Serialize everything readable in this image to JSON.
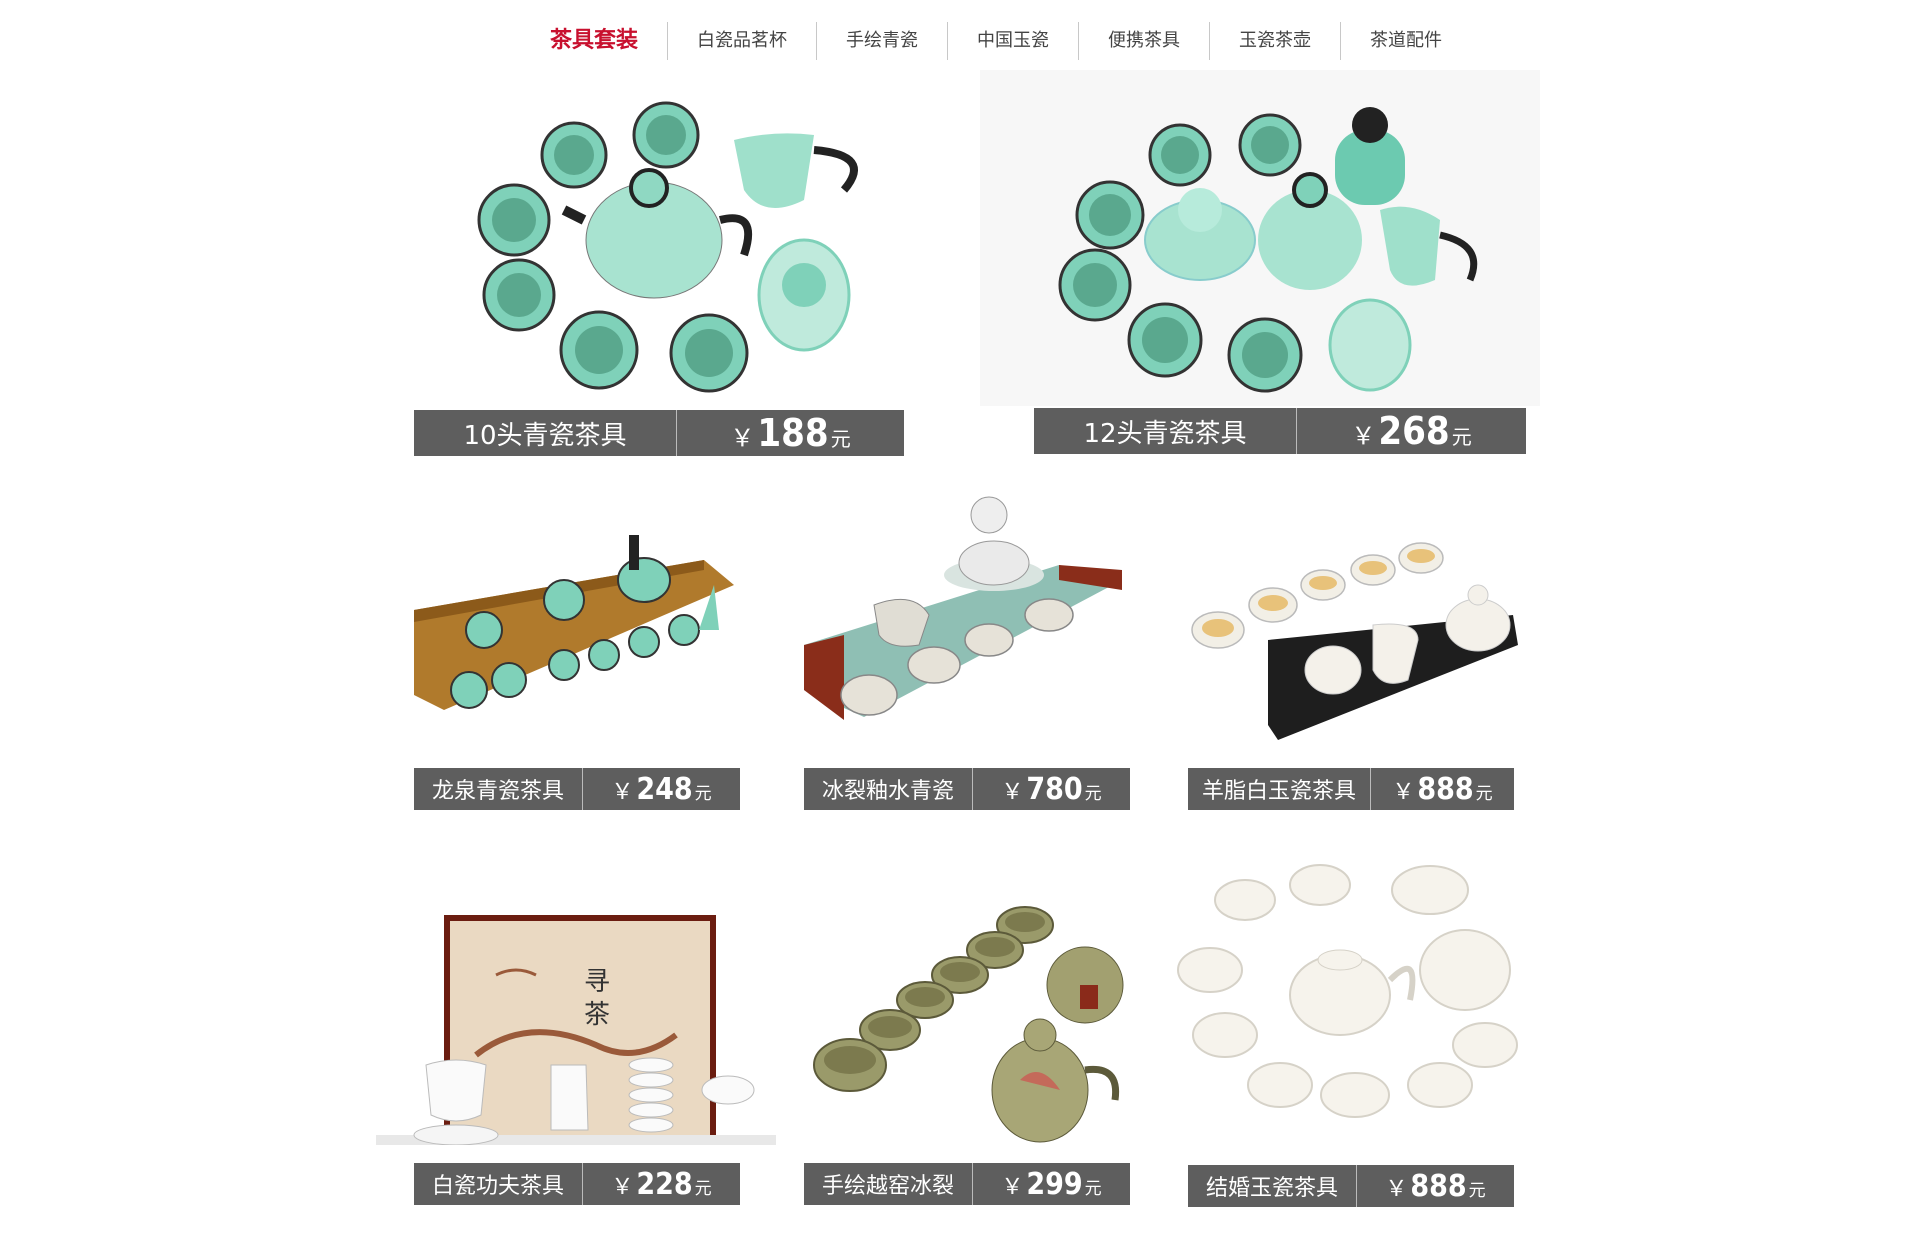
{
  "nav": {
    "items": [
      "茶具套装",
      "白瓷品茗杯",
      "手绘青瓷",
      "中国玉瓷",
      "便携茶具",
      "玉瓷茶壶",
      "茶道配件"
    ],
    "active_color": "#c8102e"
  },
  "currency": "￥",
  "unit": "元",
  "products": [
    {
      "name": "10头青瓷茶具",
      "price": "188"
    },
    {
      "name": "12头青瓷茶具",
      "price": "268"
    },
    {
      "name": "龙泉青瓷茶具",
      "price": "248"
    },
    {
      "name": "冰裂釉水青瓷",
      "price": "780"
    },
    {
      "name": "羊脂白玉瓷茶具",
      "price": "888"
    },
    {
      "name": "白瓷功夫茶具",
      "price": "228"
    },
    {
      "name": "手绘越窑冰裂",
      "price": "299"
    },
    {
      "name": "结婚玉瓷茶具",
      "price": "888"
    }
  ],
  "colors": {
    "bar": "#5e5e5e",
    "celadon": "#7fd1b9",
    "white_jade": "#f4f1ea",
    "crackle": "#9a9a6a"
  }
}
